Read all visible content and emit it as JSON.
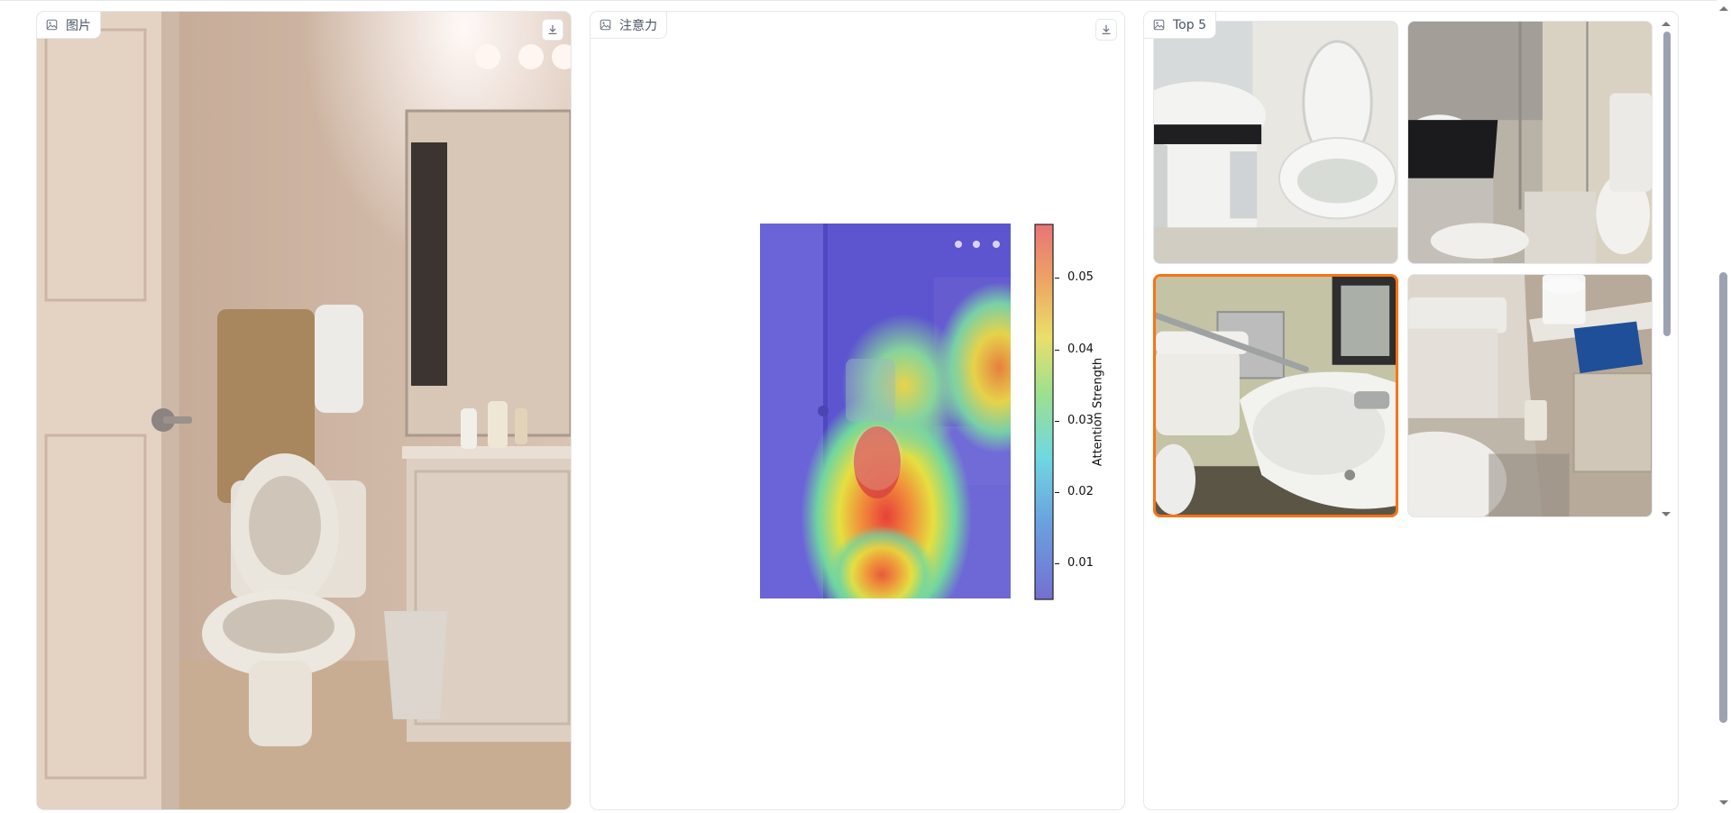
{
  "panels": {
    "image": {
      "label": "图片",
      "label_icon": "image-icon",
      "download_icon": "download-icon"
    },
    "attention": {
      "label": "注意力",
      "label_icon": "image-icon",
      "download_icon": "download-icon"
    },
    "top5": {
      "label": "Top 5",
      "label_icon": "image-icon"
    }
  },
  "colorbar": {
    "title": "Attention Strength",
    "ticks": [
      "0.05",
      "0.04",
      "0.03",
      "0.02",
      "0.01"
    ],
    "tick_values": [
      0.05,
      0.04,
      0.03,
      0.02,
      0.01
    ],
    "range": [
      0.005,
      0.0575
    ]
  },
  "gallery": {
    "count": 4,
    "selected_index": 2
  },
  "colors": {
    "accent_selected": "#f97316",
    "border": "#e5e7eb"
  }
}
